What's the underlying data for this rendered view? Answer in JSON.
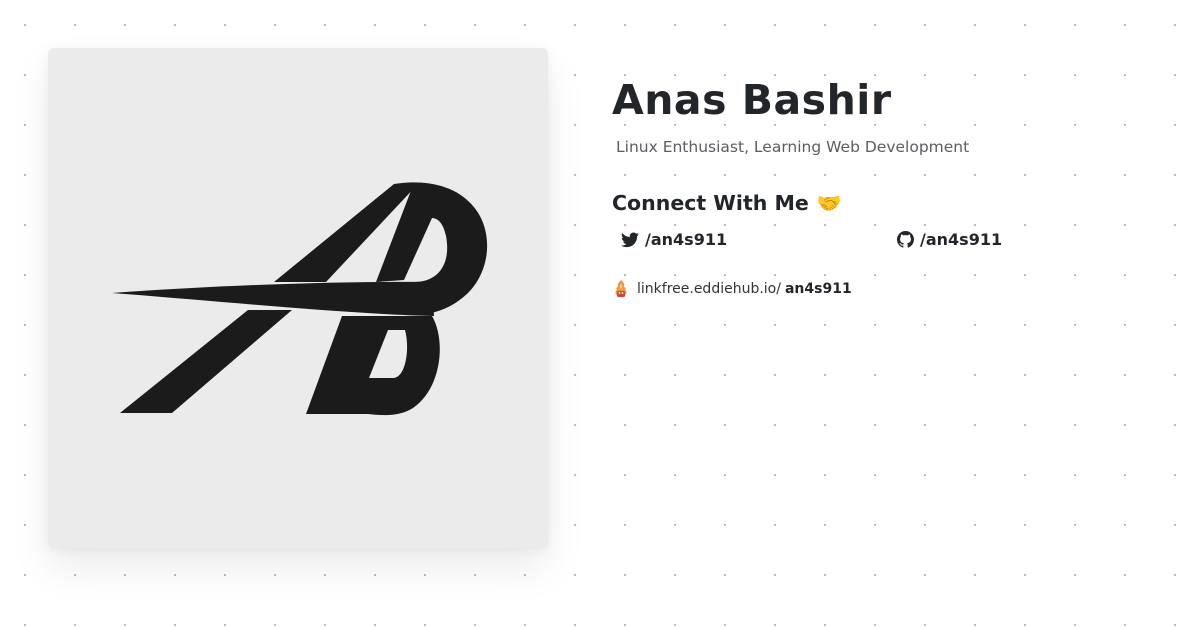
{
  "profile": {
    "name": "Anas Bashir",
    "tagline": "Linux Enthusiast, Learning Web Development"
  },
  "connect": {
    "heading": "Connect With Me",
    "emoji": "🤝",
    "links": [
      {
        "icon": "twitter-icon",
        "label": "/an4s911"
      },
      {
        "icon": "github-icon",
        "label": "/an4s911"
      }
    ]
  },
  "linkfree": {
    "icon": "linkfree-icon",
    "domain": "linkfree.eddiehub.io/",
    "username": "an4s911"
  },
  "colors": {
    "logo": "#1b1b1b",
    "card_bg": "#ebebeb",
    "text": "#22252a",
    "muted": "#5a5d62",
    "dots": "#b9b9b9"
  }
}
